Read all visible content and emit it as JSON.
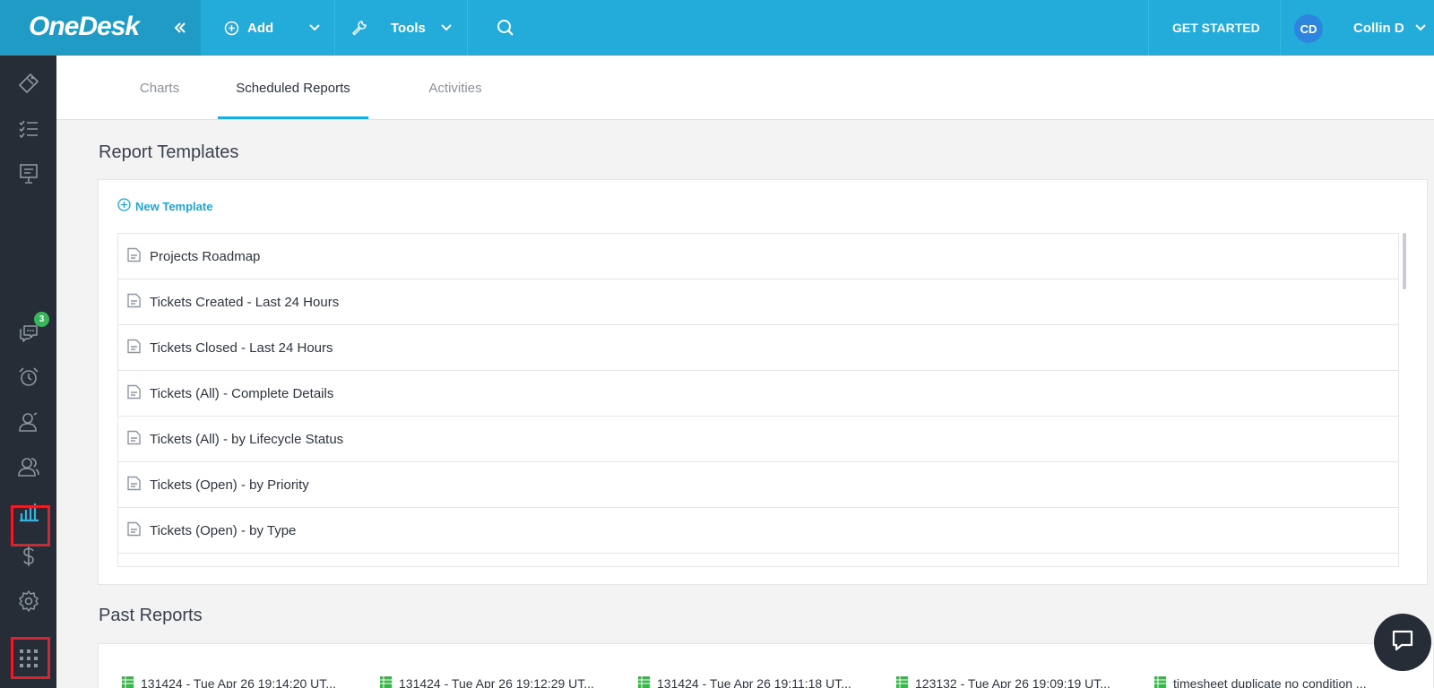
{
  "topbar": {
    "logo": "OneDesk",
    "collapse_icon": "double-chevron-left-icon",
    "add_label": "Add",
    "tools_label": "Tools",
    "get_started_label": "GET STARTED",
    "user_initials": "CD",
    "user_name": "Collin D"
  },
  "sidebar": {
    "items": [
      {
        "icon": "ticket-icon"
      },
      {
        "icon": "task-list-icon"
      },
      {
        "icon": "project-board-icon"
      },
      {
        "icon": "messages-icon",
        "badge": "3"
      },
      {
        "icon": "alarm-clock-icon"
      },
      {
        "icon": "customer-icon"
      },
      {
        "icon": "users-icon"
      },
      {
        "icon": "analytics-icon",
        "active": true
      },
      {
        "icon": "dollar-icon"
      },
      {
        "icon": "settings-icon"
      },
      {
        "icon": "apps-grid-icon"
      }
    ]
  },
  "tabs": [
    {
      "label": "Charts"
    },
    {
      "label": "Scheduled Reports",
      "active": true
    },
    {
      "label": "Activities"
    }
  ],
  "templates": {
    "title": "Report Templates",
    "new_label": "New Template",
    "items": [
      {
        "label": "Projects Roadmap"
      },
      {
        "label": "Tickets Created - Last 24 Hours"
      },
      {
        "label": "Tickets Closed - Last 24 Hours"
      },
      {
        "label": "Tickets (All) - Complete Details"
      },
      {
        "label": "Tickets (All) - by Lifecycle Status"
      },
      {
        "label": "Tickets (Open) - by Priority"
      },
      {
        "label": "Tickets (Open) - by Type"
      }
    ]
  },
  "past_reports": {
    "title": "Past Reports",
    "items": [
      {
        "label": "131424 - Tue Apr 26 19:14:20 UT..."
      },
      {
        "label": "131424 - Tue Apr 26 19:12:29 UT..."
      },
      {
        "label": "131424 - Tue Apr 26 19:11:18 UT..."
      },
      {
        "label": "123132 - Tue Apr 26 19:09:19 UT..."
      },
      {
        "label": "timesheet duplicate no condition ..."
      }
    ]
  },
  "colors": {
    "topbar": "#23acd9",
    "sidebar": "#262d36",
    "accent": "#23acd9",
    "highlight": "#e0202a",
    "badge": "#36b85a"
  }
}
